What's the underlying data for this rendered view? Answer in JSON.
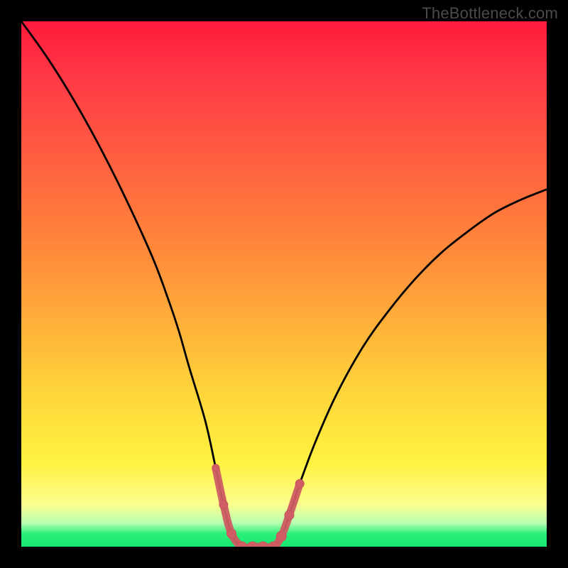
{
  "watermark": {
    "text": "TheBottleneck.com"
  },
  "colors": {
    "black": "#000000",
    "top_red": "#ff1a3c",
    "mid_red": "#ff3746",
    "orange": "#ff8a3a",
    "yellow_mid": "#ffd33a",
    "yellow_band_top": "#fff240",
    "yellow_band_bottom": "#fcff8f",
    "pale_green": "#b8ffb1",
    "green": "#2bf079",
    "green_bottom": "#18e672",
    "curve_stroke": "#000000",
    "marker_fill": "#cf5d63",
    "marker_stroke": "#c6565c"
  },
  "chart_data": {
    "type": "line",
    "title": "",
    "xlabel": "",
    "ylabel": "",
    "xlim": [
      0,
      100
    ],
    "ylim": [
      0,
      100
    ],
    "notes": "Bottleneck-style V curve. X is an implicit component-balance axis; Y is bottleneck percentage (0 at bottom = no bottleneck). Background is a vertical heat gradient (green near bottom → red near top). Values are estimated from pixel positions; axes have no ticks or labels.",
    "series": [
      {
        "name": "bottleneck-curve",
        "x": [
          0,
          5,
          10,
          15,
          20,
          25,
          28,
          30,
          32,
          35,
          37,
          38.5,
          40,
          42,
          44,
          46,
          48,
          49.5,
          51,
          53,
          56,
          60,
          65,
          70,
          75,
          80,
          85,
          90,
          95,
          100
        ],
        "y": [
          100,
          93,
          85,
          76,
          66,
          55,
          47,
          41,
          34,
          24,
          15,
          8,
          2.5,
          0,
          0,
          0,
          0,
          2,
          6,
          12,
          20,
          29,
          38,
          45,
          51,
          56,
          60,
          63.5,
          66,
          68
        ]
      }
    ],
    "markers": {
      "name": "highlighted-segment",
      "x": [
        37,
        38.5,
        40,
        42,
        44,
        46,
        48,
        49.5,
        51,
        53
      ],
      "y": [
        15,
        8,
        2.5,
        0,
        0,
        0,
        0,
        2,
        6,
        12
      ],
      "r": [
        5,
        6,
        6.5,
        7,
        7,
        7,
        7,
        7,
        6.5,
        6
      ]
    },
    "gradient_stops": [
      {
        "pos": 0.0,
        "color_key": "top_red"
      },
      {
        "pos": 0.1,
        "color_key": "mid_red"
      },
      {
        "pos": 0.44,
        "color_key": "orange"
      },
      {
        "pos": 0.7,
        "color_key": "yellow_mid"
      },
      {
        "pos": 0.84,
        "color_key": "yellow_band_top"
      },
      {
        "pos": 0.92,
        "color_key": "yellow_band_bottom"
      },
      {
        "pos": 0.955,
        "color_key": "pale_green"
      },
      {
        "pos": 0.975,
        "color_key": "green"
      },
      {
        "pos": 1.0,
        "color_key": "green_bottom"
      }
    ]
  }
}
